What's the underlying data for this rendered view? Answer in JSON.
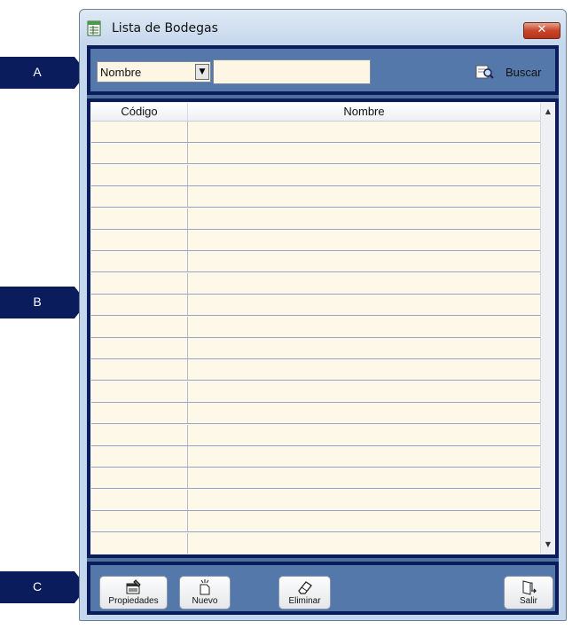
{
  "window": {
    "title": "Lista de Bodegas",
    "close_label": "✕"
  },
  "search": {
    "field_selected": "Nombre",
    "query_value": "",
    "button_label": "Buscar"
  },
  "grid": {
    "columns": [
      "Código",
      "Nombre"
    ],
    "rows": []
  },
  "toolbar": {
    "properties_label": "Propiedades",
    "new_label": "Nuevo",
    "delete_label": "Eliminar",
    "exit_label": "Salir"
  },
  "callouts": {
    "a": "A",
    "b": "B",
    "c": "C"
  },
  "colors": {
    "callout": "#0b1c5c",
    "panel": "#5578aa",
    "grid_bg": "#fdf8e8"
  }
}
